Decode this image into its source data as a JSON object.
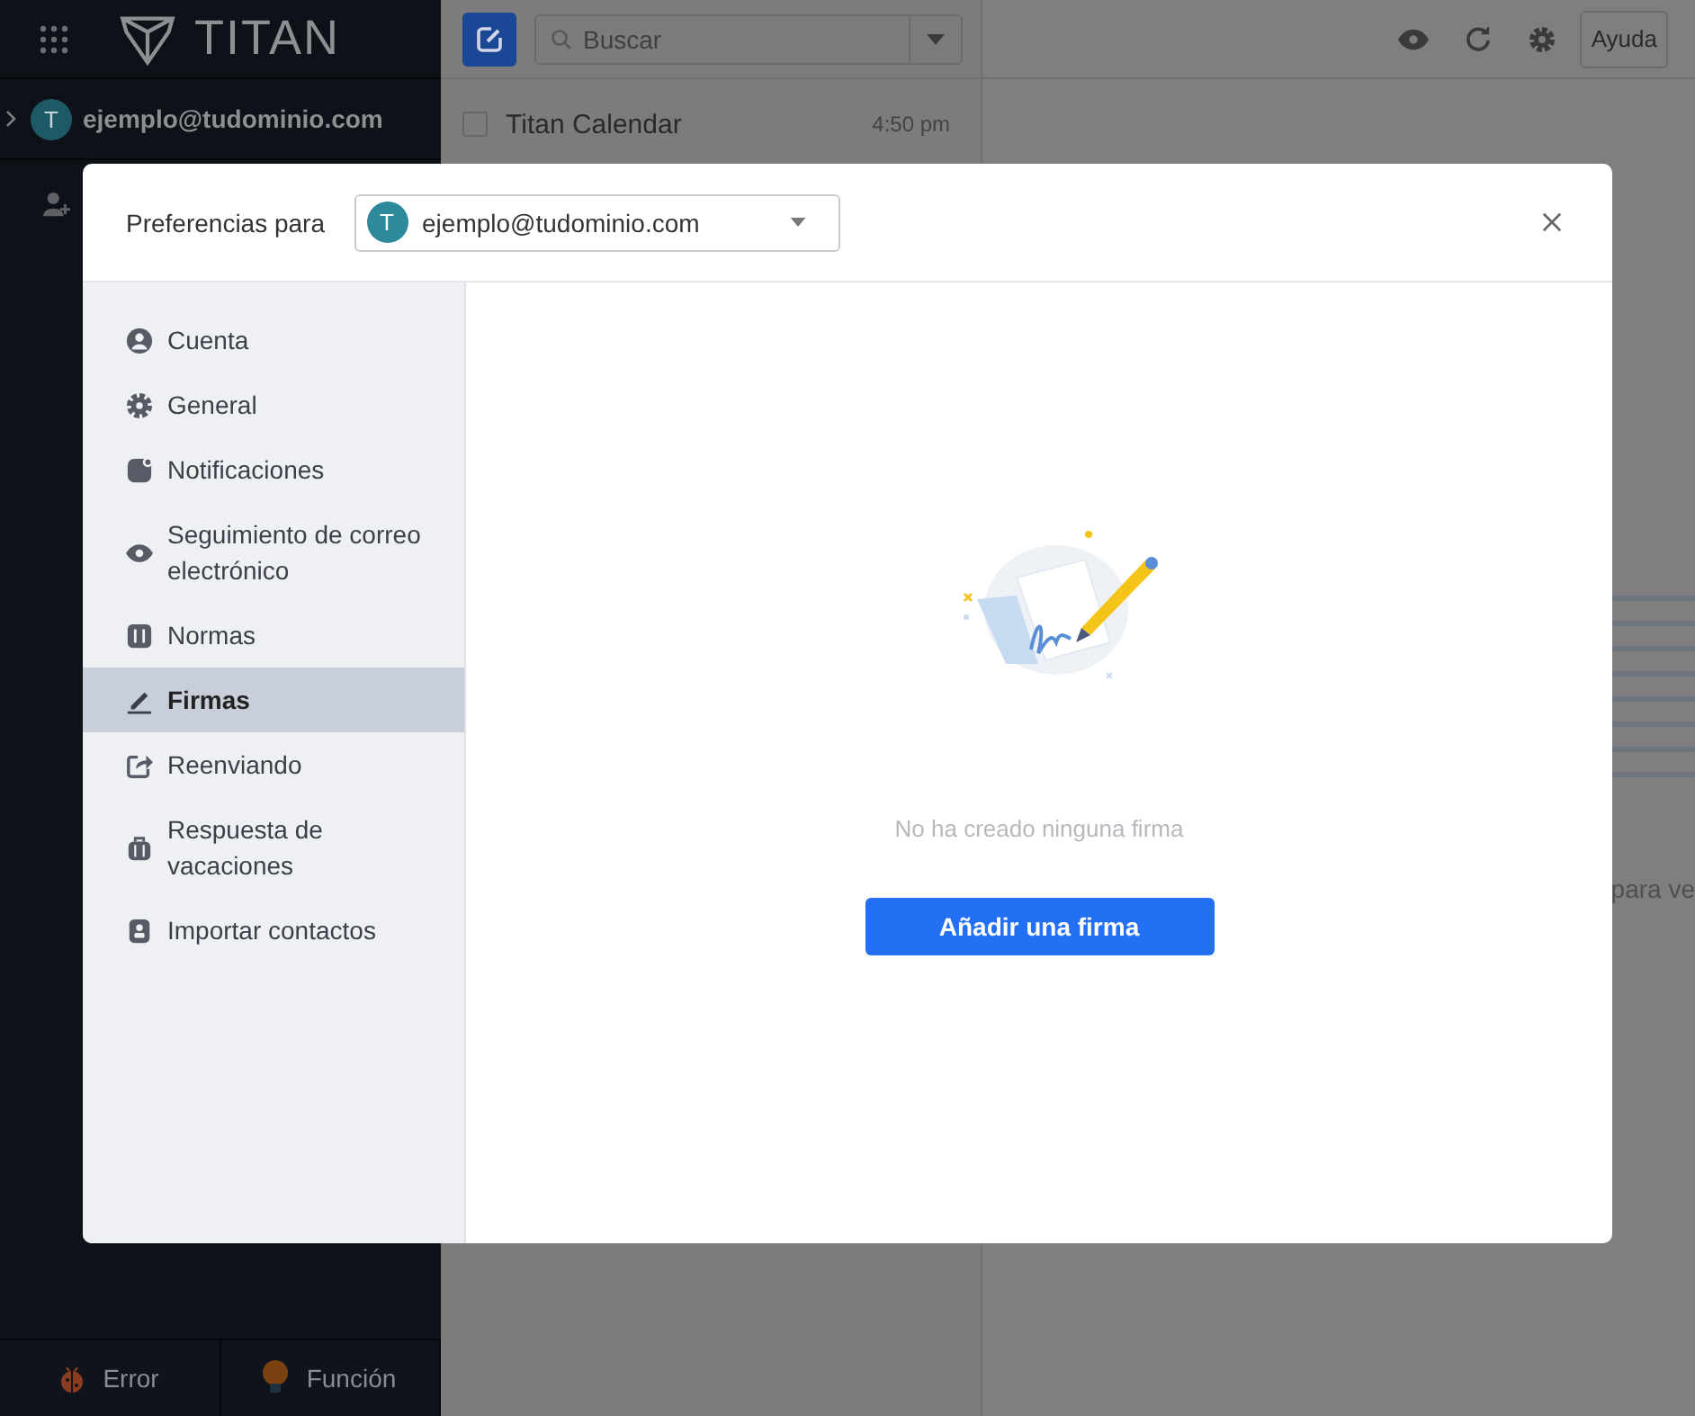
{
  "sidebar": {
    "logo": "TITAN",
    "account": {
      "avatar": "T",
      "email": "ejemplo@tudominio.com"
    },
    "footer_buttons": [
      {
        "label": "Error",
        "kind": "bug"
      },
      {
        "label": "Función",
        "kind": "bulb"
      }
    ]
  },
  "toolbar": {
    "search": {
      "placeholder": "Buscar"
    },
    "help": "Ayuda"
  },
  "mail_list": [
    {
      "sender": "Titan Calendar",
      "time": "4:50 pm",
      "checked": false
    }
  ],
  "reading_pane": {
    "hint": "para ve"
  },
  "dialog": {
    "title": "Preferencias para",
    "account": {
      "avatar": "T",
      "email": "ejemplo@tudominio.com"
    },
    "nav": [
      {
        "label": "Cuenta",
        "kind": "user",
        "selected": false
      },
      {
        "label": "General",
        "kind": "gear",
        "selected": false
      },
      {
        "label": "Notificaciones",
        "kind": "bell",
        "selected": false
      },
      {
        "label": "Seguimiento de correo electrónico",
        "kind": "eye",
        "selected": false
      },
      {
        "label": "Normas",
        "kind": "rules",
        "selected": false
      },
      {
        "label": "Firmas",
        "kind": "pen",
        "selected": true
      },
      {
        "label": "Reenviando",
        "kind": "forward",
        "selected": false
      },
      {
        "label": "Respuesta de vacaciones",
        "kind": "suitcase",
        "selected": false
      },
      {
        "label": "Importar contactos",
        "kind": "contact",
        "selected": false
      }
    ],
    "empty": {
      "message": "No ha creado ninguna firma",
      "button": "Añadir una firma"
    }
  }
}
